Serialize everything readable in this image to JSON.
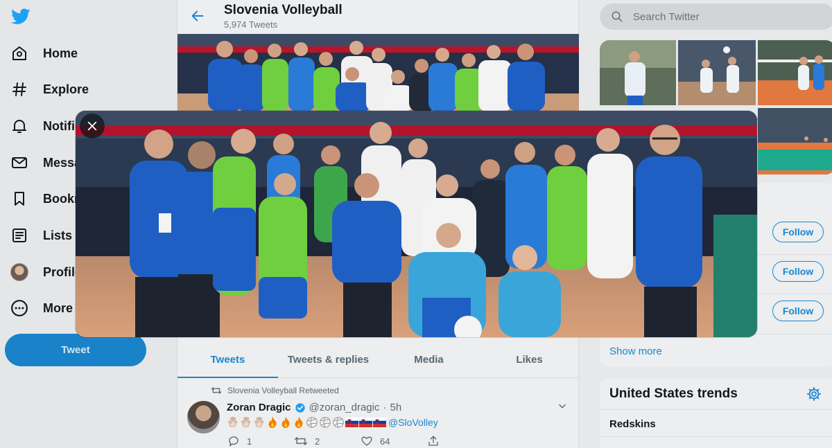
{
  "nav": {
    "items": [
      {
        "label": "Home",
        "icon": "home-icon"
      },
      {
        "label": "Explore",
        "icon": "hashtag-icon"
      },
      {
        "label": "Notifications",
        "icon": "bell-icon"
      },
      {
        "label": "Messages",
        "icon": "mail-icon"
      },
      {
        "label": "Bookmarks",
        "icon": "bookmark-icon"
      },
      {
        "label": "Lists",
        "icon": "list-icon"
      },
      {
        "label": "Profile",
        "icon": "avatar"
      },
      {
        "label": "More",
        "icon": "more-icon"
      }
    ],
    "tweet_button": "Tweet"
  },
  "profile": {
    "name": "Slovenia Volleyball",
    "tweet_count": "5,974 Tweets"
  },
  "tabs": [
    "Tweets",
    "Tweets & replies",
    "Media",
    "Likes"
  ],
  "timeline": {
    "retweet_context": "Slovenia Volleyball Retweeted",
    "author_name": "Zoran Dragic",
    "author_handle": "@zoran_dragic",
    "separator": "·",
    "time": "5h",
    "mention": "@SloVolley",
    "emoji_sequence": [
      "clap-icon",
      "clap-icon",
      "clap-icon",
      "fire-icon",
      "fire-icon",
      "fire-icon",
      "volleyball-icon",
      "volleyball-icon",
      "volleyball-icon",
      "slovenia-flag-icon",
      "slovenia-flag-icon",
      "slovenia-flag-icon"
    ],
    "replies": "1",
    "retweets": "2",
    "likes": "64"
  },
  "right": {
    "search_placeholder": "Search Twitter",
    "follow_label": "Follow",
    "show_more": "Show more",
    "trends_title": "United States trends",
    "trend_1": "Redskins"
  },
  "colors": {
    "accent": "#1a86cf",
    "tweet_button": "#1a82c8",
    "jersey_blue": "#1f5fc4",
    "jersey_green": "#6fcf3f"
  }
}
